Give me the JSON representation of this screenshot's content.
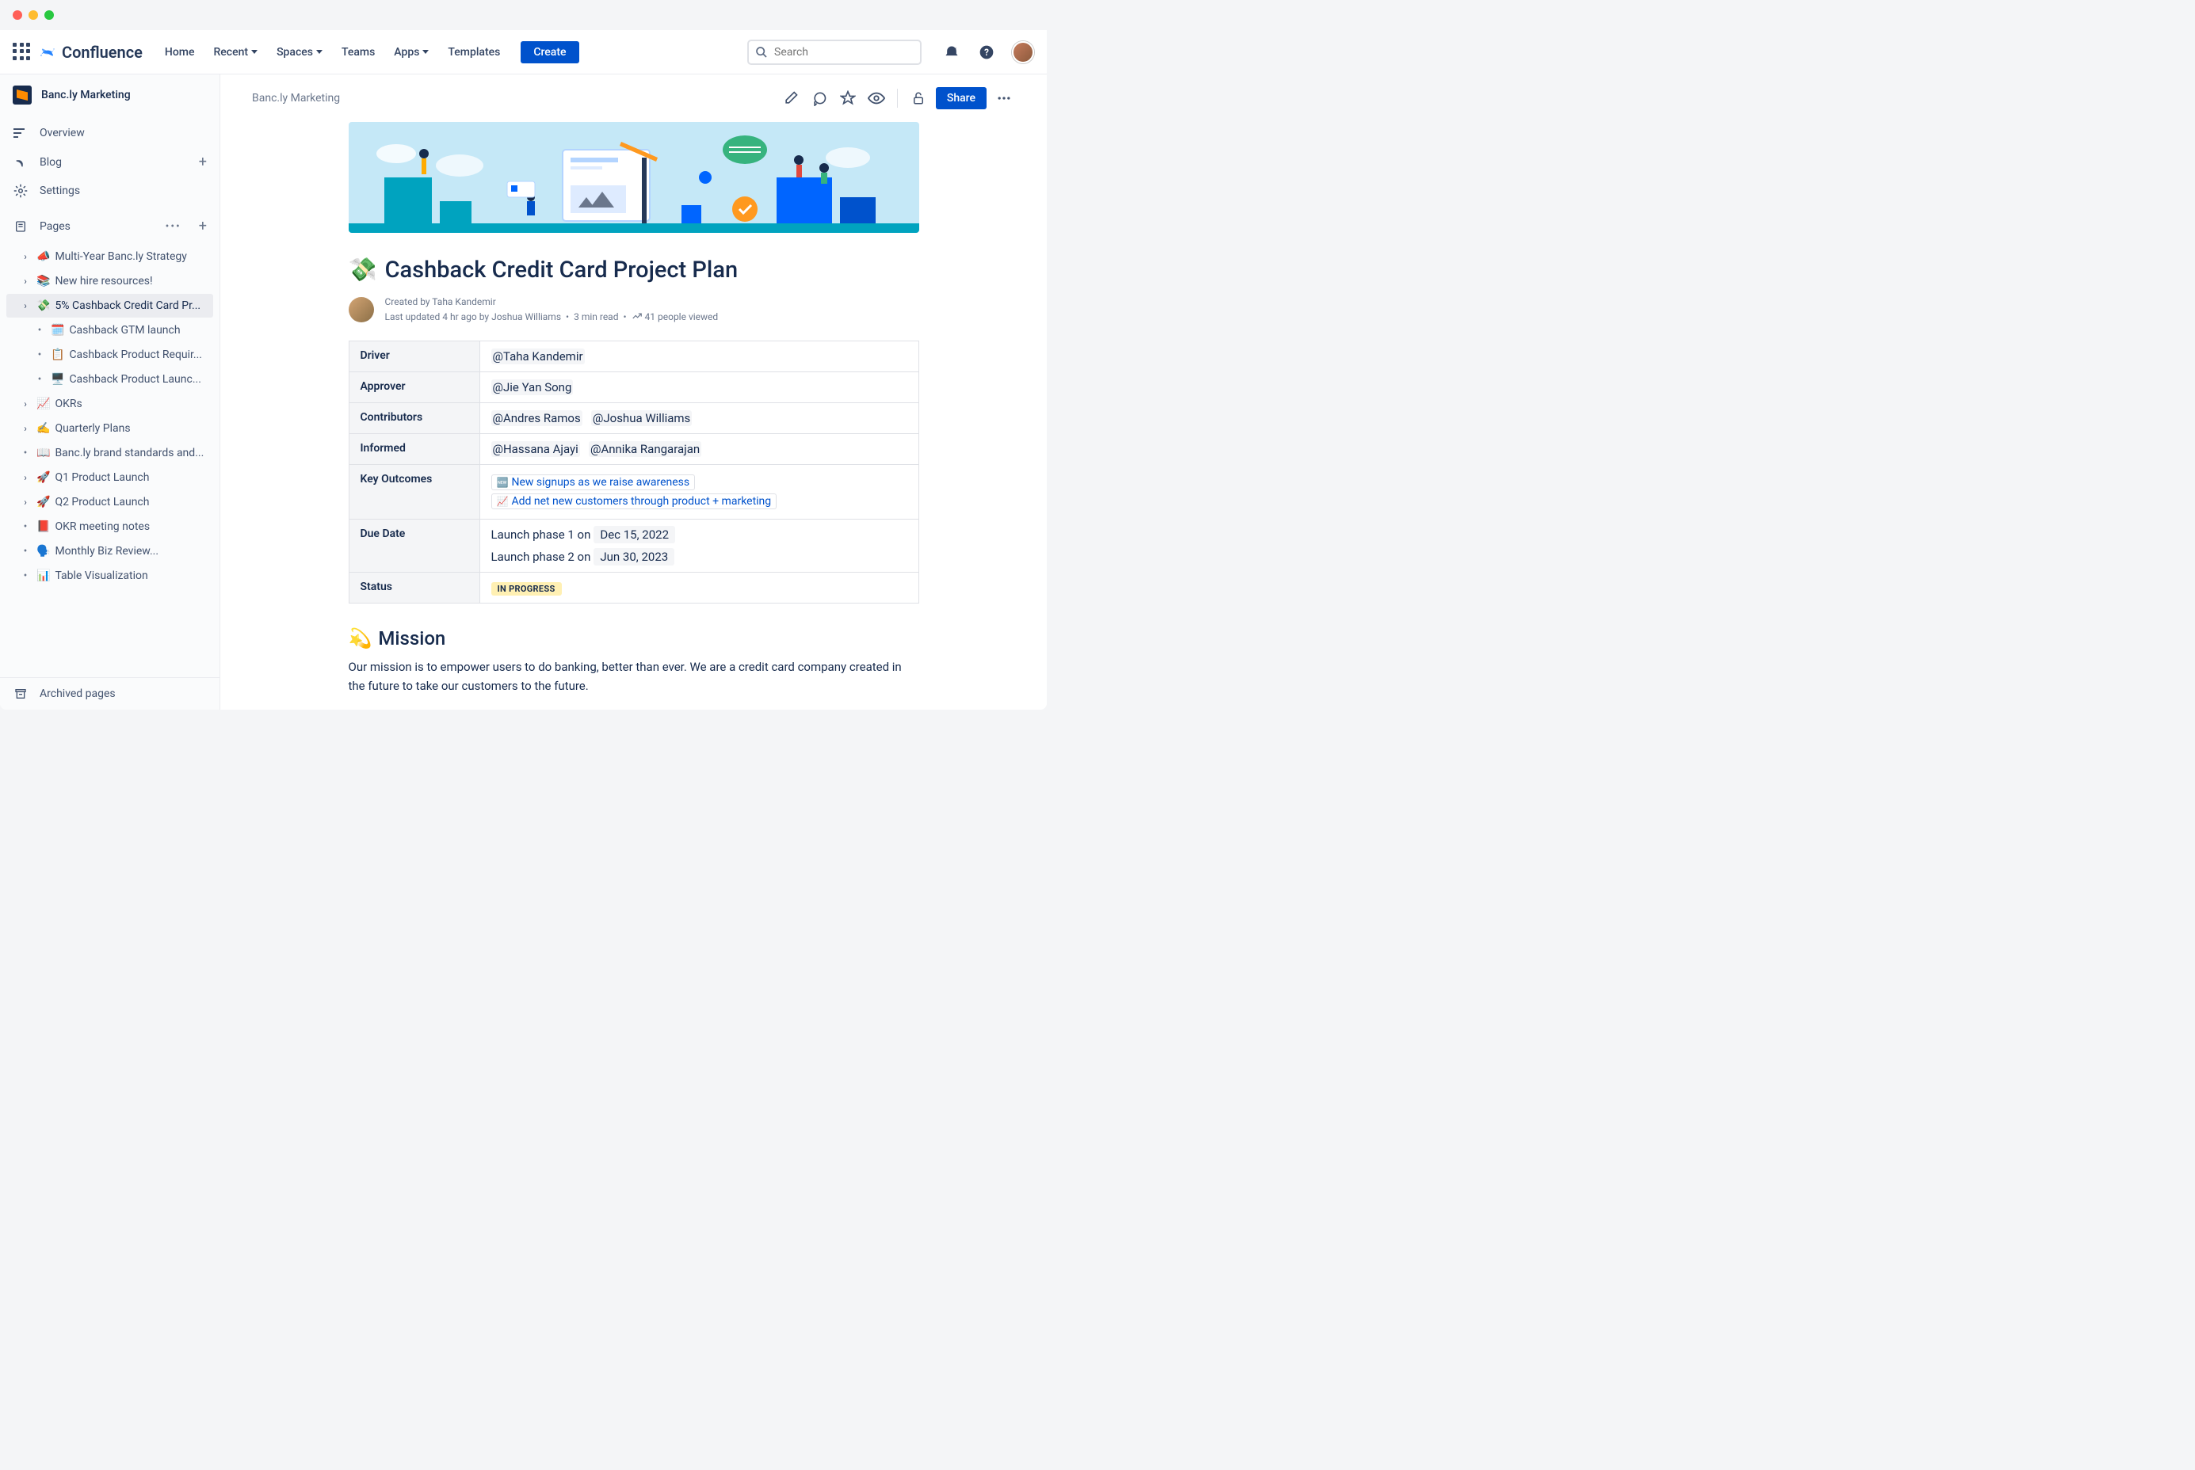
{
  "product": "Confluence",
  "nav": {
    "home": "Home",
    "recent": "Recent",
    "spaces": "Spaces",
    "teams": "Teams",
    "apps": "Apps",
    "templates": "Templates",
    "create": "Create",
    "search_placeholder": "Search"
  },
  "space": {
    "name": "Banc.ly Marketing",
    "overview": "Overview",
    "blog": "Blog",
    "settings": "Settings",
    "pages": "Pages",
    "archived": "Archived pages"
  },
  "tree": [
    {
      "emoji": "📣",
      "label": "Multi-Year Banc.ly Strategy",
      "exp": true
    },
    {
      "emoji": "📚",
      "label": "New hire resources!",
      "exp": true
    },
    {
      "emoji": "💸",
      "label": "5% Cashback Credit Card Pr...",
      "exp": true,
      "active": true
    },
    {
      "emoji": "🗓️",
      "label": "Cashback GTM launch",
      "child": true
    },
    {
      "emoji": "📋",
      "label": "Cashback Product Requir...",
      "child": true
    },
    {
      "emoji": "🖥️",
      "label": "Cashback Product Launc...",
      "child": true
    },
    {
      "emoji": "📈",
      "label": "OKRs",
      "exp": true
    },
    {
      "emoji": "✍️",
      "label": "Quarterly Plans",
      "exp": true
    },
    {
      "emoji": "📖",
      "label": "Banc.ly brand standards and..."
    },
    {
      "emoji": "🚀",
      "label": "Q1 Product Launch",
      "exp": true
    },
    {
      "emoji": "🚀",
      "label": "Q2 Product Launch",
      "exp": true
    },
    {
      "emoji": "📕",
      "label": "OKR meeting notes"
    },
    {
      "emoji": "🗣️",
      "label": "Monthly Biz Review..."
    },
    {
      "emoji": "📊",
      "label": "Table Visualization"
    }
  ],
  "page": {
    "breadcrumb": "Banc.ly Marketing",
    "share": "Share",
    "title_emoji": "💸",
    "title": "Cashback Credit Card Project Plan",
    "created_by_label": "Created by ",
    "created_by": "Taha Kandemir",
    "updated_label": "Last updated ",
    "updated_time": "4 hr ago",
    "updated_by_label": " by ",
    "updated_by": "Joshua Williams",
    "read_time": "3 min read",
    "views": "41 people viewed",
    "table": {
      "driver_label": "Driver",
      "driver": "@Taha Kandemir",
      "approver_label": "Approver",
      "approver": "@Jie Yan Song",
      "contributors_label": "Contributors",
      "contributors_1": "@Andres Ramos",
      "contributors_2": "@Joshua Williams",
      "informed_label": "Informed",
      "informed_1": "@Hassana Ajayi",
      "informed_2": "@Annika Rangarajan",
      "outcomes_label": "Key Outcomes",
      "outcome_1_emoji": "🆕",
      "outcome_1": "New signups as we raise awareness",
      "outcome_2_emoji": "📈",
      "outcome_2": "Add net new customers through product + marketing",
      "due_label": "Due Date",
      "due_1_text": "Launch phase 1 on",
      "due_1_date": "Dec 15, 2022",
      "due_2_text": "Launch phase 2 on",
      "due_2_date": "Jun 30, 2023",
      "status_label": "Status",
      "status": "IN PROGRESS"
    },
    "mission_emoji": "💫",
    "mission_title": "Mission",
    "mission_body": "Our mission is to empower users to do banking, better than ever. We are a credit card company created in the future to take our customers to the future."
  }
}
